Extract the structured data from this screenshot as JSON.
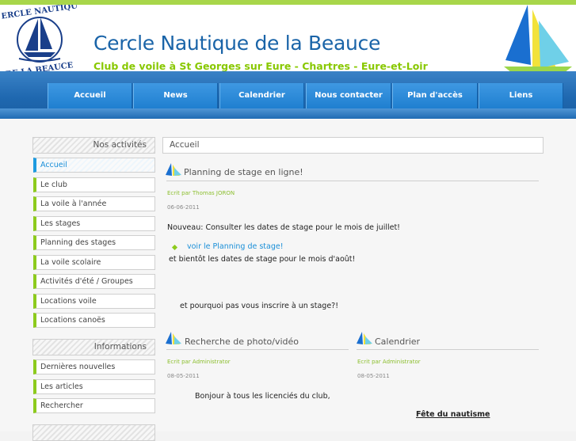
{
  "header": {
    "title": "Cercle Nautique de la Beauce",
    "subtitle": "Club de voile à St Georges sur Eure - Chartres - Eure-et-Loir",
    "logo_text_top": "CERCLE NAUTIQUE",
    "logo_text_bottom": "DE LA BEAUCE"
  },
  "nav": {
    "items": [
      "Accueil",
      "News",
      "Calendrier",
      "Nous contacter",
      "Plan d'accès",
      "Liens"
    ]
  },
  "sidebar": {
    "activities_title": "Nos activités",
    "activities": [
      "Accueil",
      "Le club",
      "La voile à l'année",
      "Les stages",
      "Planning des stages",
      "La voile scolaire",
      "Activités d'été / Groupes",
      "Locations voile",
      "Locations canoës"
    ],
    "info_title": "Informations",
    "info": [
      "Dernières nouvelles",
      "Les articles",
      "Rechercher"
    ]
  },
  "main": {
    "breadcrumb": "Accueil",
    "article1": {
      "title": "Planning de stage en ligne!",
      "author": "Ecrit par Thomas JORON",
      "date": "06-06-2011",
      "p1": "Nouveau: Consulter les dates de stage pour le mois de juillet!",
      "link": "voir le Planning de stage!",
      "p2": "et bientôt les dates de stage pour le mois d'août!",
      "p3": "et pourquoi pas vous inscrire à un stage?!"
    },
    "article2": {
      "title": "Recherche de photo/vidéo",
      "author": "Ecrit par Administrator",
      "date": "08-05-2011",
      "p1": "Bonjour à tous les licenciés du club,"
    },
    "article3": {
      "title": "Calendrier",
      "author": "Ecrit par Administrator",
      "date": "08-05-2011",
      "p1": "Fête du nautisme"
    }
  },
  "colors": {
    "brand_blue": "#1a64a8",
    "accent_green": "#88c800",
    "nav_blue": "#1f7fd0",
    "active_blue": "#1a8fd8"
  }
}
